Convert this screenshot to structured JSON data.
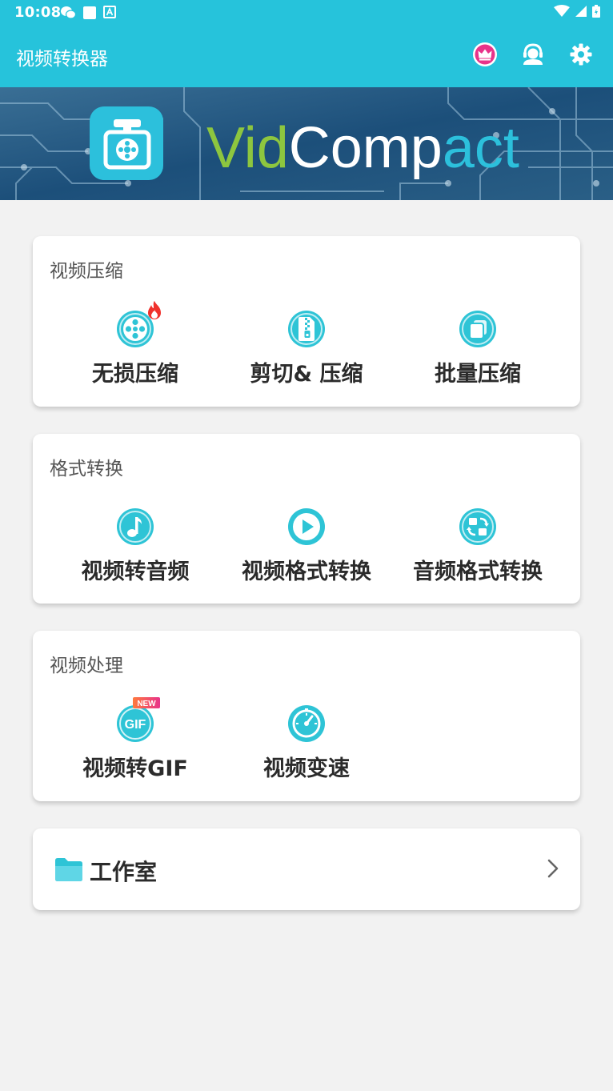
{
  "status_bar": {
    "time": "10:08",
    "icons": [
      "wechat-icon",
      "square-notification-icon",
      "a-notification-icon",
      "wifi-icon",
      "cellular-signal-icon",
      "battery-icon"
    ]
  },
  "app_bar": {
    "title": "视频转换器",
    "actions": [
      "vip-crown-icon",
      "customer-service-icon",
      "settings-gear-icon"
    ]
  },
  "banner": {
    "logo_text_1": "Vid",
    "logo_text_2": "Comp",
    "logo_text_3": "act"
  },
  "sections": {
    "compress": {
      "title": "视频压缩",
      "items": [
        {
          "label": "无损压缩",
          "icon": "film-reel-icon",
          "badge": "hot-flame-icon"
        },
        {
          "label": "剪切& 压缩",
          "icon": "zip-file-icon"
        },
        {
          "label": "批量压缩",
          "icon": "batch-copy-icon"
        }
      ]
    },
    "convert": {
      "title": "格式转换",
      "items": [
        {
          "label": "视频转音频",
          "icon": "music-note-icon"
        },
        {
          "label": "视频格式转换",
          "icon": "play-icon"
        },
        {
          "label": "音频格式转换",
          "icon": "swap-format-icon"
        }
      ]
    },
    "process": {
      "title": "视频处理",
      "items": [
        {
          "label": "视频转GIF",
          "icon": "gif-icon",
          "badge_text": "NEW",
          "icon_text": "GIF"
        },
        {
          "label": "视频变速",
          "icon": "speedometer-icon"
        }
      ]
    }
  },
  "studio": {
    "label": "工作室"
  },
  "colors": {
    "primary": "#26c3db",
    "background": "#f2f2f2",
    "card": "#ffffff",
    "icon_teal": "#2ec4d6",
    "badge_pink": "#e8338a",
    "logo_green": "#8dc63f"
  }
}
